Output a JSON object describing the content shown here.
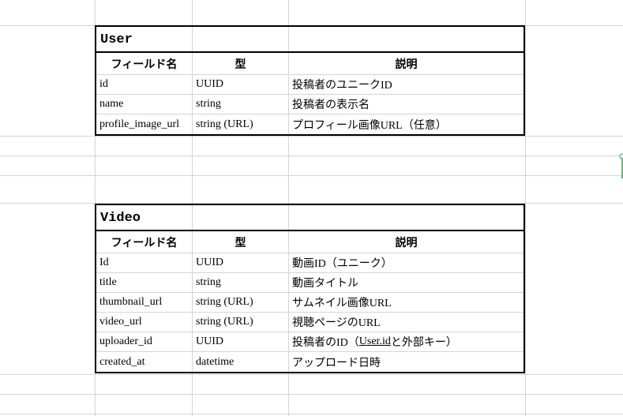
{
  "tables": [
    {
      "title": "User",
      "headers": [
        "フィールド名",
        "型",
        "説明"
      ],
      "rows": [
        [
          "id",
          "UUID",
          "投稿者のユニークID"
        ],
        [
          "name",
          "string",
          "投稿者の表示名"
        ],
        [
          "profile_image_url",
          "string (URL)",
          "プロフィール画像URL（任意）"
        ]
      ]
    },
    {
      "title": "Video",
      "headers": [
        "フィールド名",
        "型",
        "説明"
      ],
      "rows": [
        [
          "Id",
          "UUID",
          "動画ID（ユニーク）"
        ],
        [
          "title",
          "string",
          "動画タイトル"
        ],
        [
          "thumbnail_url",
          "string (URL)",
          "サムネイル画像URL"
        ],
        [
          "video_url",
          "string (URL)",
          "視聴ページのURL"
        ],
        [
          "uploader_id",
          "UUID",
          "投稿者のID（",
          "User.id",
          "と外部キー）"
        ],
        [
          "created_at",
          "datetime",
          "アップロード日時"
        ]
      ]
    }
  ]
}
